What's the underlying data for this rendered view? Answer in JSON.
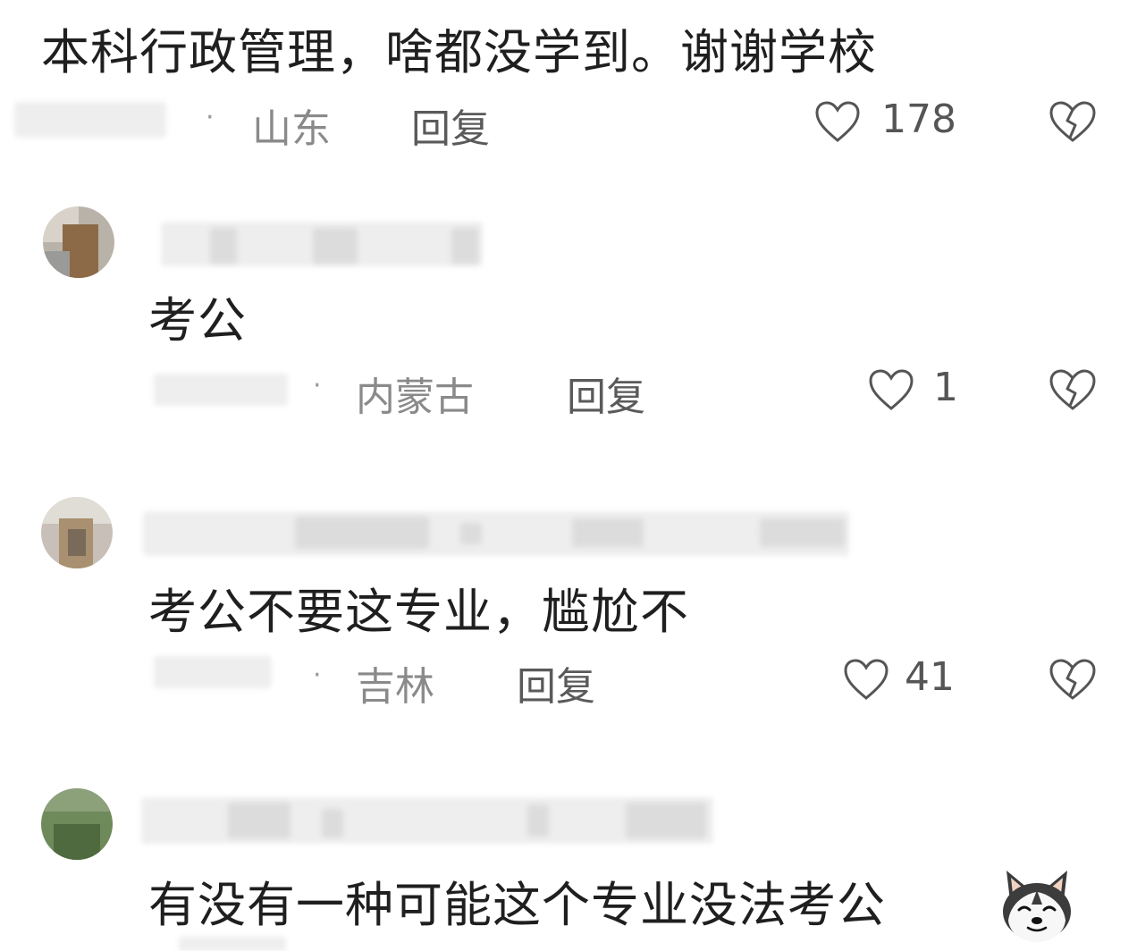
{
  "colors": {
    "text": "#1f1f1f",
    "meta": "#8a8a8a",
    "icon": "#555555",
    "background": "#ffffff"
  },
  "comments": [
    {
      "text": "本科行政管理，啥都没学到。谢谢学校",
      "location": "山东",
      "reply_label": "回复",
      "likes": "178",
      "like_icon": "heart-outline-icon",
      "dislike_icon": "broken-heart-icon"
    },
    {
      "text": "考公",
      "location": "内蒙古",
      "reply_label": "回复",
      "likes": "1",
      "like_icon": "heart-outline-icon",
      "dislike_icon": "broken-heart-icon"
    },
    {
      "text": "考公不要这专业，尴尬不",
      "location": "吉林",
      "reply_label": "回复",
      "likes": "41",
      "like_icon": "heart-outline-icon",
      "dislike_icon": "broken-heart-icon"
    },
    {
      "text": "有没有一种可能这个专业没法考公",
      "emoji_icon": "doge-emoji-icon"
    }
  ]
}
